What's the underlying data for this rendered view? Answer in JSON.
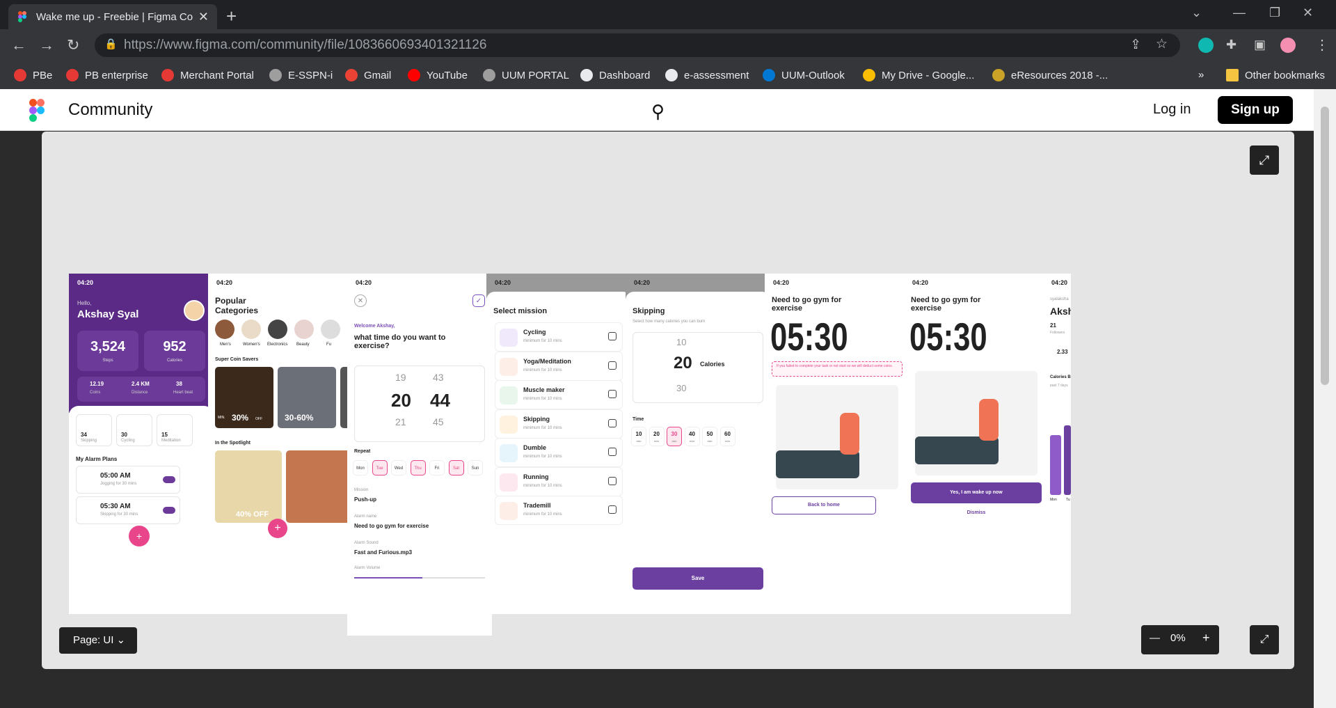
{
  "browser": {
    "tab_title": "Wake me up - Freebie | Figma Co",
    "url_host": "https://www.figma.com",
    "url_path": "/community/file/1083660693401321126"
  },
  "bookmarks": [
    {
      "label": "PBe",
      "color": "#e53935"
    },
    {
      "label": "PB enterprise",
      "color": "#e53935"
    },
    {
      "label": "Merchant Portal",
      "color": "#e53935"
    },
    {
      "label": "E-SSPN-i",
      "color": "#9e9e9e"
    },
    {
      "label": "Gmail",
      "color": "#ea4335"
    },
    {
      "label": "YouTube",
      "color": "#ff0000"
    },
    {
      "label": "UUM PORTAL",
      "color": "#9e9e9e"
    },
    {
      "label": "Dashboard",
      "color": "#e8eaed"
    },
    {
      "label": "e-assessment",
      "color": "#e8eaed"
    },
    {
      "label": "UUM-Outlook",
      "color": "#0078d4"
    },
    {
      "label": "My Drive - Google...",
      "color": "#fbbc04"
    },
    {
      "label": "eResources 2018 -...",
      "color": "#c9a227"
    }
  ],
  "bookmarks_more": "»",
  "other_bookmarks": "Other bookmarks",
  "header": {
    "title": "Community",
    "login": "Log in",
    "signup": "Sign up"
  },
  "viewer": {
    "page_label": "Page: UI",
    "zoom": "0%"
  },
  "frames": {
    "status_time": "04:20",
    "f1": {
      "hello": "Hello,",
      "name": "Akshay Syal",
      "steps": "3,524",
      "steps_label": "Steps",
      "calories": "952",
      "calories_label": "Calories",
      "coins": "12.19",
      "coins_label": "Coins",
      "distance": "2.4 KM",
      "distance_label": "Distance",
      "heart": "38",
      "heart_label": "Heart beat",
      "a1": "34",
      "a1l": "Skipping",
      "a2": "30",
      "a2l": "Cycling",
      "a3": "15",
      "a3l": "Meditation",
      "plans": "My Alarm Plans",
      "al1": "05:00 AM",
      "al1s": "Jogging for 30 mins",
      "al2": "05:30 AM",
      "al2s": "Skipping for 30 mins",
      "min": "min"
    },
    "f2": {
      "title": "Popular Categories",
      "c1": "Men's",
      "c2": "Women's",
      "c3": "Electronics",
      "c4": "Beauty",
      "c5": "Fu",
      "savers": "Super Coin Savers",
      "p1": "30%",
      "p2": "30-60%",
      "spot": "In the Spotlight",
      "off": "40% OFF",
      "min_label": "MIN.",
      "off_label": "OFF"
    },
    "f3": {
      "welcome": "Welcome Akshay,",
      "q": "what time do you want to exercise?",
      "h1": "19",
      "h2": "20",
      "h3": "21",
      "m1": "43",
      "m2": "44",
      "m3": "45",
      "repeat": "Repeat",
      "days": [
        "Mon",
        "Tue",
        "Wed",
        "Thu",
        "Fri",
        "Sat",
        "Sun"
      ],
      "mission_l": "Mission",
      "mission": "Push-up",
      "name_l": "Alarm name",
      "name": "Need to go gym for exercise",
      "sound_l": "Alarm Sound",
      "sound": "Fast and Furious.mp3",
      "vol_l": "Alarm Volume",
      "volume_value": 0.52
    },
    "f4": {
      "title": "Select mission",
      "items": [
        {
          "t": "Cycling",
          "c": "#efe9fb"
        },
        {
          "t": "Yoga/Meditation",
          "c": "#fdeee8"
        },
        {
          "t": "Muscle maker",
          "c": "#e8f6ec"
        },
        {
          "t": "Skipping",
          "c": "#fff3e0"
        },
        {
          "t": "Dumble",
          "c": "#e6f4fb"
        },
        {
          "t": "Running",
          "c": "#fde8ef"
        },
        {
          "t": "Trademill",
          "c": "#fdeee8"
        }
      ],
      "sub": "minimum for 10 mins"
    },
    "f5": {
      "title": "Skipping",
      "sub": "Select how many calories you can burn",
      "v1": "10",
      "v2": "20",
      "v3": "30",
      "unit": "Calories",
      "time": "Time",
      "opts": [
        "10",
        "20",
        "30",
        "40",
        "50",
        "60"
      ],
      "opt_unit": "min",
      "save": "Save"
    },
    "f6": {
      "title": "Need to go gym for exercise",
      "clock": "05:30",
      "warn": "If you failed to complete your task or not start so we will deduct some coins.",
      "btn": "Back to home"
    },
    "f7": {
      "title": "Need to go gym for exercise",
      "clock": "05:30",
      "btn": "Yes, I am wake up now",
      "dismiss": "Dismiss"
    },
    "f8": {
      "name_small": "syalaksha",
      "name": "Aksh",
      "n": "21",
      "fl": "Followers",
      "val": "2.33",
      "cal": "Calories B",
      "past": "past 7 days",
      "d1": "Mon",
      "d2": "Tu"
    }
  }
}
